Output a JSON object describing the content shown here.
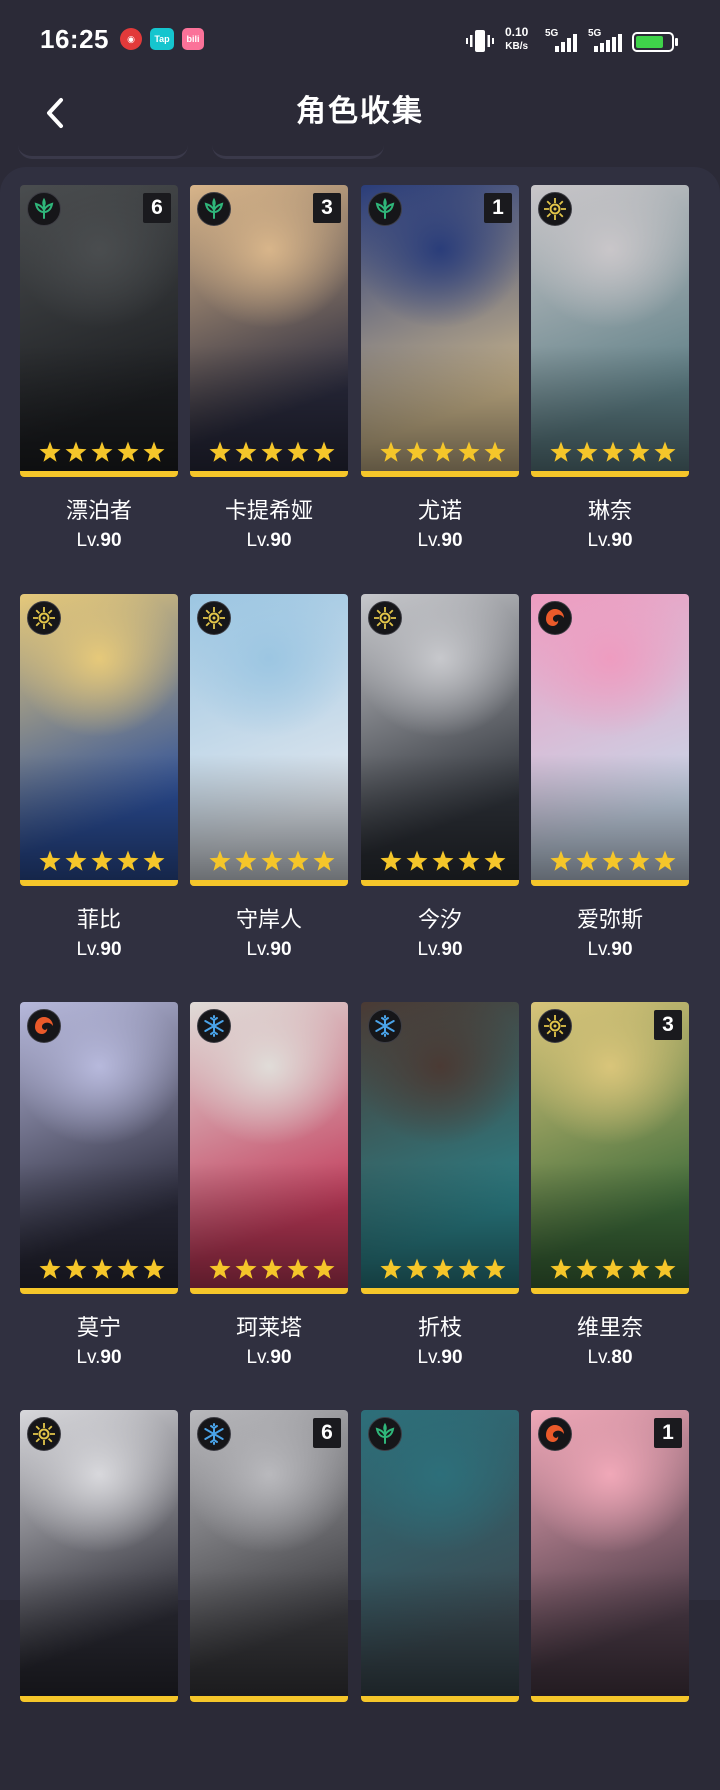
{
  "status_bar": {
    "time": "16:25",
    "apps": [
      {
        "name": "netease-music-icon",
        "glyph": "◉"
      },
      {
        "name": "taptap-icon",
        "glyph": "Tap"
      },
      {
        "name": "bilibili-icon",
        "glyph": "bili"
      }
    ],
    "net_speed_value": "0.10",
    "net_speed_unit": "KB/s",
    "signal_1_label": "5G",
    "signal_2_label": "5G",
    "battery_level": 0.78
  },
  "header": {
    "title": "角色收集",
    "back_icon": "chevron-left-icon"
  },
  "level_prefix": "Lv.",
  "colors": {
    "background": "#2b2a37",
    "panel": "#303040",
    "star": "#f5c62a",
    "rarity_bar": "#f5c62a",
    "element_aero": "#2fb67a",
    "element_spectro": "#e3c64a",
    "element_fusion": "#ea5a2a",
    "element_glacio": "#4aa3e8"
  },
  "characters": [
    {
      "name": "漂泊者",
      "level": "90",
      "element": "aero",
      "sequence": "6",
      "stars": 5,
      "colors": [
        "#4a4d4f",
        "#1d1f22"
      ]
    },
    {
      "name": "卡提希娅",
      "level": "90",
      "element": "aero",
      "sequence": "3",
      "stars": 5,
      "colors": [
        "#d8b58a",
        "#2a2b3e"
      ]
    },
    {
      "name": "尤诺",
      "level": "90",
      "element": "aero",
      "sequence": "1",
      "stars": 5,
      "colors": [
        "#2a3d7a",
        "#c9b48a"
      ]
    },
    {
      "name": "琳奈",
      "level": "90",
      "element": "spectro",
      "sequence": "",
      "stars": 5,
      "colors": [
        "#c9c6c9",
        "#5e7f86"
      ]
    },
    {
      "name": "菲比",
      "level": "90",
      "element": "spectro",
      "sequence": "",
      "stars": 5,
      "colors": [
        "#e6c97a",
        "#2c4f9a"
      ]
    },
    {
      "name": "守岸人",
      "level": "90",
      "element": "spectro",
      "sequence": "",
      "stars": 5,
      "colors": [
        "#9cc6e2",
        "#dfe6ee"
      ]
    },
    {
      "name": "今汐",
      "level": "90",
      "element": "spectro",
      "sequence": "",
      "stars": 5,
      "colors": [
        "#c7c8cc",
        "#2d3138"
      ]
    },
    {
      "name": "爱弥斯",
      "level": "90",
      "element": "fusion",
      "sequence": "",
      "stars": 5,
      "colors": [
        "#ee9cc0",
        "#c8d6e8"
      ]
    },
    {
      "name": "莫宁",
      "level": "90",
      "element": "fusion",
      "sequence": "",
      "stars": 5,
      "colors": [
        "#b7b9dc",
        "#2a2a3a"
      ]
    },
    {
      "name": "珂莱塔",
      "level": "90",
      "element": "glacio",
      "sequence": "",
      "stars": 5,
      "colors": [
        "#e0dcd8",
        "#c23a5a"
      ]
    },
    {
      "name": "折枝",
      "level": "90",
      "element": "glacio",
      "sequence": "",
      "stars": 5,
      "colors": [
        "#4a3a34",
        "#2b7f86"
      ]
    },
    {
      "name": "维里奈",
      "level": "80",
      "element": "spectro",
      "sequence": "3",
      "stars": 5,
      "colors": [
        "#d9c57a",
        "#3d6b3a"
      ]
    },
    {
      "name": "",
      "level": "",
      "element": "spectro",
      "sequence": "",
      "stars": 0,
      "colors": [
        "#d8d8dc",
        "#2a2a33"
      ]
    },
    {
      "name": "",
      "level": "",
      "element": "glacio",
      "sequence": "6",
      "stars": 0,
      "colors": [
        "#b9b9bd",
        "#3a3a3e"
      ]
    },
    {
      "name": "",
      "level": "",
      "element": "aero",
      "sequence": "",
      "stars": 0,
      "colors": [
        "#2d6f7a",
        "#3b4a52"
      ]
    },
    {
      "name": "",
      "level": "",
      "element": "fusion",
      "sequence": "1",
      "stars": 0,
      "colors": [
        "#f0a8b8",
        "#4a3a46"
      ]
    }
  ]
}
